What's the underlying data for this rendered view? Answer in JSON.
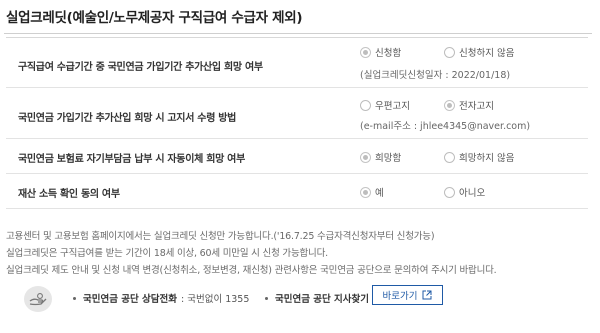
{
  "page": {
    "title": "실업크레딧(예술인/노무제공자 구직급여 수급자 제외)"
  },
  "rows": [
    {
      "question": "구직급여 수급기간 중 국민연금 가입기간 추가산입 희망 여부",
      "options": [
        "신청함",
        "신청하지 않음"
      ],
      "selected": 0,
      "sub": "(실업크레딧신청일자 : 2022/01/18)"
    },
    {
      "question": "국민연금 가입기간 추가산입 희망 시 고지서 수령 방법",
      "options": [
        "우편고지",
        "전자고지"
      ],
      "selected": 1,
      "sub": "(e-mail주소 : jhlee4345@naver.com)"
    },
    {
      "question": "국민연금 보험료 자기부담금 납부 시 자동이체 희망 여부",
      "options": [
        "희망함",
        "희망하지 않음"
      ],
      "selected": 0,
      "sub": ""
    },
    {
      "question": "재산 소득 확인 동의 여부",
      "options": [
        "예",
        "아니오"
      ],
      "selected": 0,
      "sub": ""
    }
  ],
  "notes": [
    "고용센터 및 고용보험 홈페이지에서는 실업크레딧 신청만 가능합니다.('16.7.25 수급자격신청자부터 신청가능)",
    "실업크레딧은 구직급여를 받는 기간이 18세 이상, 60세 미만일 시 신청 가능합니다.",
    "실업크레딧 제도 안내 및 신청 내역 변경(신청취소, 정보변경, 재신청) 관련사항은 국민연금 공단으로 문의하여 주시기 바랍니다."
  ],
  "footer": {
    "icon": "hand-coin-icon",
    "contact_label": "국민연금 공단 상담전화",
    "contact_value": ": 국번없이 1355",
    "branch_label": "국민연금 공단 지사찾기",
    "go_button": "바로가기"
  }
}
